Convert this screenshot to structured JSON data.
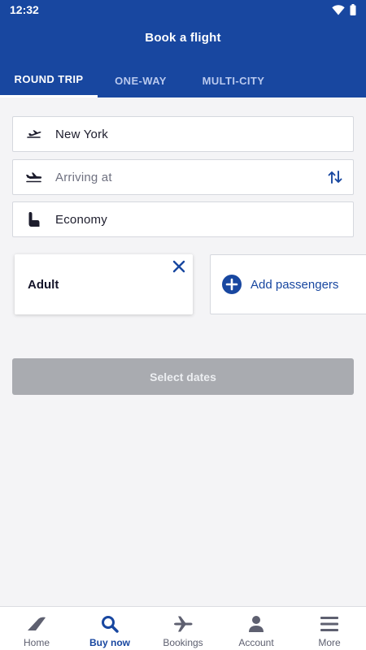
{
  "status_bar": {
    "time": "12:32"
  },
  "header": {
    "title": "Book a flight"
  },
  "tabs": [
    {
      "label": "ROUND TRIP",
      "active": true
    },
    {
      "label": "ONE-WAY",
      "active": false
    },
    {
      "label": "MULTI-CITY",
      "active": false
    }
  ],
  "form": {
    "departure": {
      "value": "New York",
      "icon": "takeoff-icon"
    },
    "arrival": {
      "placeholder": "Arriving at",
      "icon": "landing-icon"
    },
    "cabin": {
      "value": "Economy",
      "icon": "seat-icon"
    }
  },
  "passengers": {
    "adult_label": "Adult",
    "add_label": "Add passengers"
  },
  "select_dates_label": "Select dates",
  "bottom_nav": [
    {
      "label": "Home",
      "icon": "home-icon",
      "active": false
    },
    {
      "label": "Buy now",
      "icon": "search-icon",
      "active": true
    },
    {
      "label": "Bookings",
      "icon": "plane-icon",
      "active": false
    },
    {
      "label": "Account",
      "icon": "person-icon",
      "active": false
    },
    {
      "label": "More",
      "icon": "menu-icon",
      "active": false
    }
  ],
  "colors": {
    "primary": "#1847a0",
    "background": "#f4f4f6",
    "disabled_button": "#a9abb0"
  }
}
